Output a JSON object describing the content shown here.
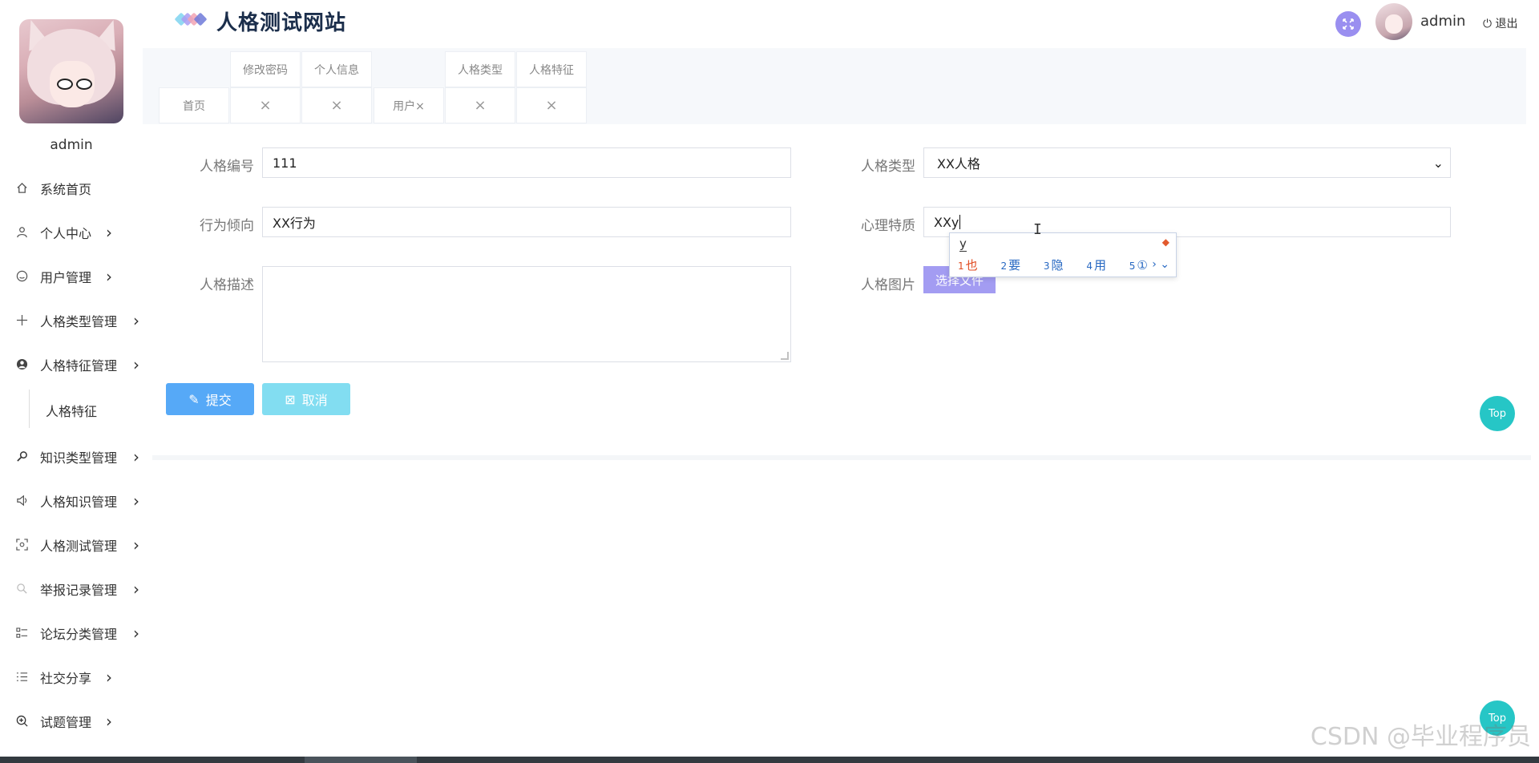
{
  "header": {
    "site_title": "人格测试网站",
    "username": "admin",
    "logout_label": "退出",
    "logo_colors": [
      "#7fd3f0",
      "#a99cf2",
      "#f2a3b3",
      "#6f7ad9"
    ]
  },
  "sidebar": {
    "username": "admin",
    "items": [
      {
        "label": "系统首页",
        "icon": "home-icon",
        "has_arrow": false
      },
      {
        "label": "个人中心",
        "icon": "user-icon",
        "has_arrow": true
      },
      {
        "label": "用户管理",
        "icon": "smile-icon",
        "has_arrow": true
      },
      {
        "label": "人格类型管理",
        "icon": "plus-icon",
        "has_arrow": true
      },
      {
        "label": "人格特征管理",
        "icon": "person-icon",
        "has_arrow": true,
        "expanded": true
      },
      {
        "label": "知识类型管理",
        "icon": "key-icon",
        "has_arrow": true
      },
      {
        "label": "人格知识管理",
        "icon": "speaker-icon",
        "has_arrow": true
      },
      {
        "label": "人格测试管理",
        "icon": "scan-icon",
        "has_arrow": true
      },
      {
        "label": "举报记录管理",
        "icon": "search-icon",
        "has_arrow": true
      },
      {
        "label": "论坛分类管理",
        "icon": "list-icon",
        "has_arrow": true
      },
      {
        "label": "社交分享",
        "icon": "checklist-icon",
        "has_arrow": true
      },
      {
        "label": "试题管理",
        "icon": "zoom-icon",
        "has_arrow": true
      }
    ],
    "submenu_label": "人格特征"
  },
  "tabs": {
    "top_row": [
      "修改密码",
      "个人信息",
      "人格类型",
      "人格特征"
    ],
    "bottom_row": [
      "首页",
      "×",
      "×",
      "用户×",
      "×",
      "×"
    ]
  },
  "form": {
    "fields": {
      "code_label": "人格编号",
      "code_value": "111",
      "type_label": "人格类型",
      "type_value": "XX人格",
      "behavior_label": "行为倾向",
      "behavior_value": "XX行为",
      "trait_label": "心理特质",
      "trait_value": "XXy",
      "desc_label": "人格描述",
      "image_label": "人格图片",
      "file_button": "选择文件"
    },
    "submit_label": "提交",
    "cancel_label": "取消"
  },
  "ime": {
    "composition": "y",
    "candidates": [
      {
        "num": "1",
        "text": "也"
      },
      {
        "num": "2",
        "text": "要"
      },
      {
        "num": "3",
        "text": "隐"
      },
      {
        "num": "4",
        "text": "用"
      },
      {
        "num": "5",
        "text": "①"
      }
    ]
  },
  "top_button_label": "Top",
  "watermark": "CSDN @毕业程序员"
}
